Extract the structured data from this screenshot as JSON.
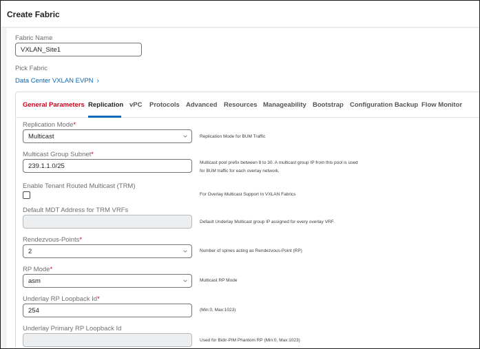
{
  "dialog": {
    "title": "Create Fabric"
  },
  "fabric_name": {
    "label": "Fabric Name",
    "value": "VXLAN_Site1"
  },
  "pick_fabric": {
    "label": "Pick Fabric",
    "link": "Data Center VXLAN EVPN"
  },
  "tabs": [
    {
      "label": "General Parameters",
      "state": "error"
    },
    {
      "label": "Replication",
      "state": "active"
    },
    {
      "label": "vPC",
      "state": "normal"
    },
    {
      "label": "Protocols",
      "state": "normal"
    },
    {
      "label": "Advanced",
      "state": "normal"
    },
    {
      "label": "Resources",
      "state": "normal"
    },
    {
      "label": "Manageability",
      "state": "normal"
    },
    {
      "label": "Bootstrap",
      "state": "normal"
    },
    {
      "label": "Configuration Backup",
      "state": "normal"
    },
    {
      "label": "Flow Monitor",
      "state": "normal"
    }
  ],
  "fields": {
    "replication_mode": {
      "label": "Replication Mode",
      "required": true,
      "value": "Multicast",
      "help": "Replication Mode for BUM Traffic"
    },
    "multicast_group_subnet": {
      "label": "Multicast Group Subnet",
      "required": true,
      "value": "239.1.1.0/25",
      "help_line1": "Multicast pool prefix between 8 to 30. A multicast group IP from this pool is used",
      "help_line2": "for BUM traffic for each overlay network."
    },
    "trm": {
      "label": "Enable Tenant Routed Multicast (TRM)",
      "checked": false,
      "help": "For Overlay Multicast Support In VXLAN Fabrics"
    },
    "default_mdt": {
      "label": "Default MDT Address for TRM VRFs",
      "value": "",
      "help": "Default Underlay Multicast group IP assigned for every overlay VRF."
    },
    "rendezvous_points": {
      "label": "Rendezvous-Points",
      "required": true,
      "value": "2",
      "help": "Number of spines acting as Rendezvous-Point (RP)"
    },
    "rp_mode": {
      "label": "RP Mode",
      "required": true,
      "value": "asm",
      "help": "Multicast RP Mode"
    },
    "underlay_rp_loopback": {
      "label": "Underlay RP Loopback Id",
      "required": true,
      "value": "254",
      "help": "(Min:0, Max:1023)"
    },
    "underlay_primary_rp_loopback": {
      "label": "Underlay Primary RP Loopback Id",
      "value": "",
      "help": "Used for Bidir-PIM Phantom RP (Min:0, Max:1023)"
    }
  },
  "required_marker": "*",
  "colors": {
    "accent": "#0468b8",
    "error": "#d0021b",
    "border": "#6f7377",
    "disabled_bg": "#eceeef"
  }
}
